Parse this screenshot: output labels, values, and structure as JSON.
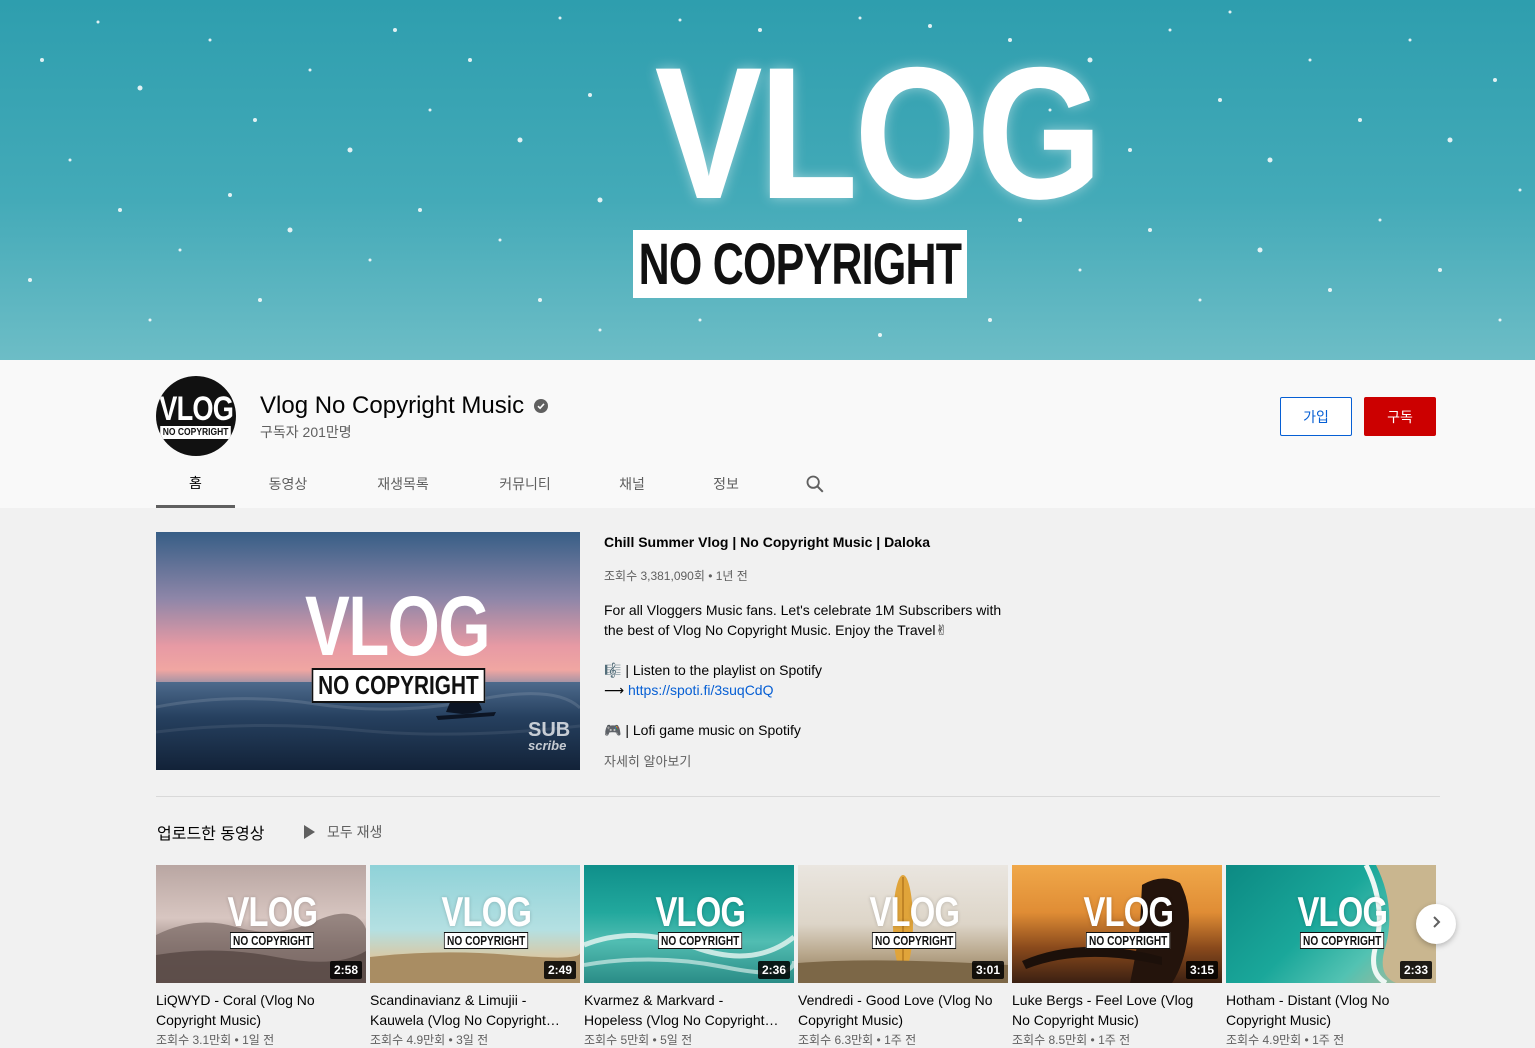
{
  "banner": {
    "logo_main": "VLOG",
    "logo_sub": "NO COPYRIGHT"
  },
  "channel": {
    "name": "Vlog No Copyright Music",
    "subscribers": "구독자 201만명",
    "avatar_main": "VLOG",
    "avatar_sub": "NO COPYRIGHT",
    "join_label": "가입",
    "subscribe_label": "구독",
    "subscribe_color": "#cc0000"
  },
  "tabs": [
    {
      "label": "홈",
      "active": true
    },
    {
      "label": "동영상"
    },
    {
      "label": "재생목록"
    },
    {
      "label": "커뮤니티"
    },
    {
      "label": "채널"
    },
    {
      "label": "정보"
    }
  ],
  "featured": {
    "title": "Chill Summer Vlog | No Copyright Music | Daloka",
    "meta": "조회수 3,381,090회 • 1년 전",
    "thumb_main": "VLOG",
    "thumb_sub": "NO COPYRIGHT",
    "thumb_watermark_1": "SUB",
    "thumb_watermark_2": "scribe",
    "desc_line1": "For all Vloggers Music fans. Let's celebrate 1M Subscribers with",
    "desc_line2": "the best of Vlog No Copyright Music. Enjoy the Travel✌",
    "desc_line3": "🎼 | Listen to the playlist on Spotify",
    "desc_line4_arrow": "⟶",
    "desc_link": "https://spoti.fi/3suqCdQ",
    "desc_line5": "🎮 | Lofi game music on Spotify",
    "more_label": "자세히 알아보기"
  },
  "shelf": {
    "title": "업로드한 동영상",
    "play_all": "모두 재생",
    "videos": [
      {
        "title": "LiQWYD - Coral (Vlog No Copyright Music)",
        "duration": "2:58",
        "meta": "조회수 3.1만회 • 1일 전"
      },
      {
        "title": "Scandinavianz & Limujii - Kauwela (Vlog No Copyright Music)",
        "duration": "2:49",
        "meta": "조회수 4.9만회 • 3일 전"
      },
      {
        "title": "Kvarmez & Markvard - Hopeless (Vlog No Copyright Music)",
        "duration": "2:36",
        "meta": "조회수 5만회 • 5일 전"
      },
      {
        "title": "Vendredi - Good Love (Vlog No Copyright Music)",
        "duration": "3:01",
        "meta": "조회수 6.3만회 • 1주 전"
      },
      {
        "title": "Luke Bergs - Feel Love (Vlog No Copyright Music)",
        "duration": "3:15",
        "meta": "조회수 8.5만회 • 1주 전"
      },
      {
        "title": "Hotham - Distant (Vlog No Copyright Music)",
        "duration": "2:33",
        "meta": "조회수 4.9만회 • 1주 전"
      }
    ]
  },
  "icons": {
    "verified": "check-circle-icon",
    "search": "search-icon",
    "play": "play-icon",
    "next": "chevron-right-icon"
  }
}
